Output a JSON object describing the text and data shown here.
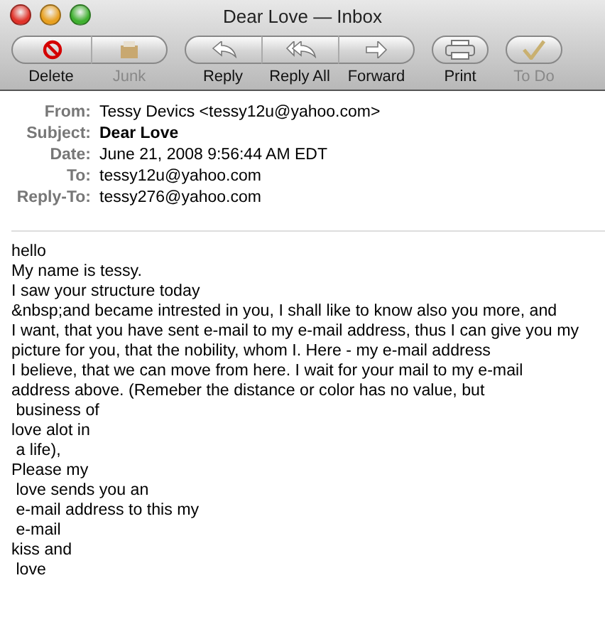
{
  "window": {
    "title": "Dear Love — Inbox"
  },
  "toolbar": [
    {
      "buttons": [
        {
          "kind": "delete",
          "label": "Delete",
          "disabled": false
        },
        {
          "kind": "junk",
          "label": "Junk",
          "disabled": true
        }
      ]
    },
    {
      "buttons": [
        {
          "kind": "reply",
          "label": "Reply",
          "disabled": false
        },
        {
          "kind": "reply_all",
          "label": "Reply All",
          "disabled": false
        },
        {
          "kind": "forward",
          "label": "Forward",
          "disabled": false
        }
      ]
    },
    {
      "buttons": [
        {
          "kind": "print",
          "label": "Print",
          "disabled": false
        }
      ]
    },
    {
      "buttons": [
        {
          "kind": "todo",
          "label": "To Do",
          "disabled": true
        }
      ]
    }
  ],
  "headers": [
    {
      "label": "From:",
      "value": "Tessy Devics <tessy12u@yahoo.com>",
      "bold": false
    },
    {
      "label": "Subject:",
      "value": "Dear Love",
      "bold": true
    },
    {
      "label": "Date:",
      "value": "June 21, 2008 9:56:44 AM EDT",
      "bold": false
    },
    {
      "label": "To:",
      "value": "tessy12u@yahoo.com",
      "bold": false
    },
    {
      "label": "Reply-To:",
      "value": "tessy276@yahoo.com",
      "bold": false
    }
  ],
  "body": [
    "hello",
    "My name is tessy.",
    "I saw your structure today",
    "&nbsp;and became intrested in you, I shall like to know also you more, and",
    "I want, that you have sent e-mail to my e-mail address, thus I can give you my",
    "picture for you, that the nobility, whom I. Here - my e-mail address",
    "I believe, that we can move from here. I wait for your mail to my e-mail",
    "address above. (Remeber the distance or color has no value, but",
    " business of",
    "love alot in",
    " a life),",
    "Please my",
    " love sends you an",
    " e-mail address to this my",
    " e-mail",
    "kiss and",
    " love"
  ]
}
